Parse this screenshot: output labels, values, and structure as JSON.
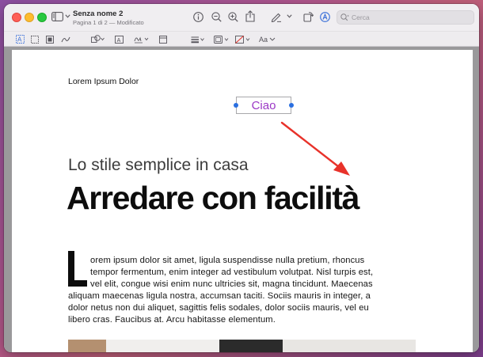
{
  "window": {
    "title": "Senza nome 2",
    "subtitle": "Pagina 1 di 2 — Modificato"
  },
  "toolbar": {
    "search_placeholder": "Cerca",
    "icons": [
      "sidebar-icon",
      "chevron-down-icon",
      "info-icon",
      "zoom-out-icon",
      "zoom-in-icon",
      "share-icon",
      "markup-pen-icon",
      "chevron-down-icon",
      "rotate-icon",
      "markup-circle-icon",
      "search-icon"
    ]
  },
  "markup_toolbar": {
    "tools": [
      "text-selection-icon",
      "rect-selection-icon",
      "redact-icon",
      "sketch-icon",
      "shapes-icon",
      "text-box-icon",
      "signature-icon",
      "note-icon",
      "shape-style-icon",
      "border-color-icon",
      "fill-color-icon",
      "text-style-icon"
    ],
    "text_style_label": "Aa"
  },
  "document": {
    "header": "Lorem Ipsum Dolor",
    "annotation_text": "Ciao",
    "annotation_color": "#9b37c6",
    "arrow_color": "#e8322a",
    "subtitle": "Lo stile semplice in casa",
    "headline": "Arredare con facilità",
    "dropcap_letter": "L",
    "body_lines": [
      "orem ipsum dolor sit amet, ligula suspendisse nulla pretium, rhoncus",
      "tempor fermentum, enim integer ad vestibulum volutpat. Nisl turpis est,",
      "vel elit, congue wisi enim nunc ultricies sit, magna tincidunt. Maecenas",
      "aliquam maecenas ligula nostra, accumsan taciti. Sociis mauris in integer, a",
      "dolor netus non dui aliquet, sagittis felis sodales, dolor sociis mauris, vel eu",
      "libero cras. Faucibus at. Arcu habitasse elementum."
    ]
  }
}
